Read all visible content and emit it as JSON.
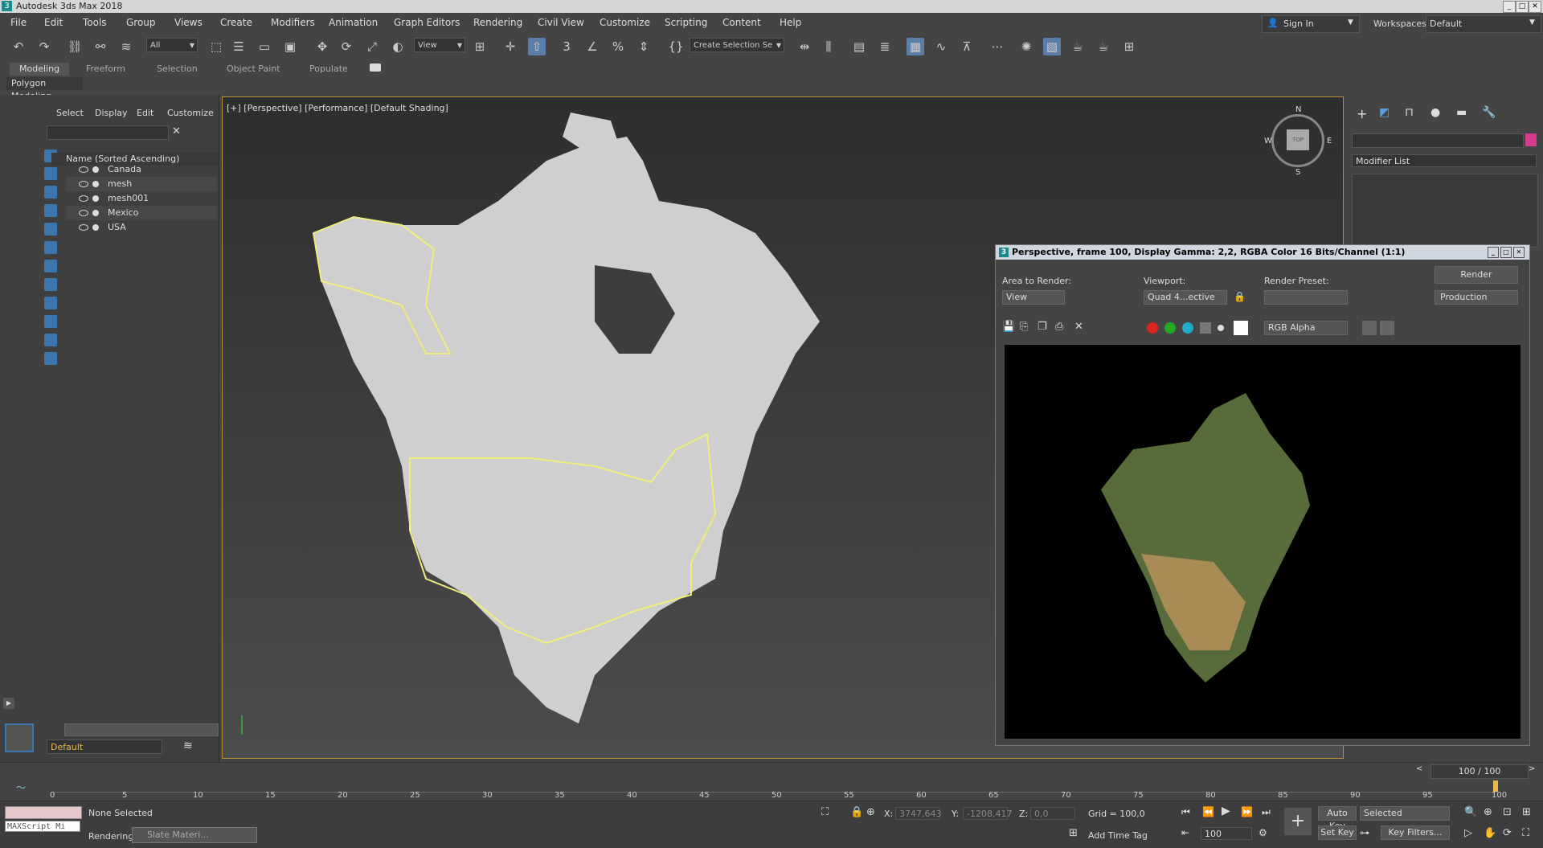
{
  "app": {
    "title": "Autodesk 3ds Max 2018",
    "logo": "3"
  },
  "menu": [
    "File",
    "Edit",
    "Tools",
    "Group",
    "Views",
    "Create",
    "Modifiers",
    "Animation",
    "Graph Editors",
    "Rendering",
    "Civil View",
    "Customize",
    "Scripting",
    "Content",
    "Help"
  ],
  "header": {
    "sign_in": "Sign In",
    "workspaces_label": "Workspaces:",
    "workspaces_value": "Default"
  },
  "toolbar": {
    "filter": "All",
    "ref_coord": "View",
    "selection_set": "Create Selection Se"
  },
  "ribbon": {
    "tabs": [
      "Modeling",
      "Freeform",
      "Selection",
      "Object Paint",
      "Populate"
    ],
    "subtab": "Polygon Modeling"
  },
  "explorer": {
    "menu": [
      "Select",
      "Display",
      "Edit",
      "Customize"
    ],
    "column_header": "Name (Sorted Ascending)",
    "items": [
      "Canada",
      "mesh",
      "mesh001",
      "Mexico",
      "USA"
    ],
    "layer": "Default"
  },
  "viewport": {
    "label": "[+] [Perspective] [Performance] [Default Shading]",
    "viewcube": {
      "top": "TOP",
      "n": "N",
      "s": "S",
      "w": "W",
      "e": "E"
    }
  },
  "command_panel": {
    "modifier_list": "Modifier List"
  },
  "render_window": {
    "title": "Perspective, frame 100, Display Gamma: 2,2, RGBA Color 16 Bits/Channel (1:1)",
    "area_label": "Area to Render:",
    "area_value": "View",
    "viewport_label": "Viewport:",
    "viewport_value": "Quad 4...ective",
    "preset_label": "Render Preset:",
    "preset_value": "",
    "render_button": "Render",
    "production": "Production",
    "channel": "RGB Alpha"
  },
  "timeline": {
    "frame": "100 / 100",
    "ticks": [
      "0",
      "5",
      "10",
      "15",
      "20",
      "25",
      "30",
      "35",
      "40",
      "45",
      "50",
      "55",
      "60",
      "65",
      "70",
      "75",
      "80",
      "85",
      "90",
      "95",
      "100"
    ]
  },
  "status": {
    "maxscript": "MAXScript Mi",
    "selection": "None Selected",
    "rendering": "Rendering",
    "slate": "Slate Materi...",
    "x_label": "X:",
    "x_value": "3747,643",
    "y_label": "Y:",
    "y_value": "-1208,417",
    "z_label": "Z:",
    "z_value": "0,0",
    "grid": "Grid = 100,0",
    "add_time_tag": "Add Time Tag",
    "auto_key": "Auto Key",
    "set_key": "Set Key",
    "selected": "Selected",
    "key_filters": "Key Filters...",
    "frame_value": "100"
  }
}
